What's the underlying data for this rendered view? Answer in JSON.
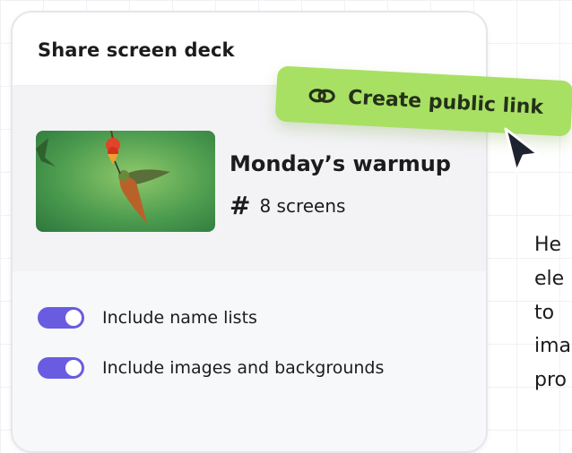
{
  "panel": {
    "title": "Share screen deck"
  },
  "deck": {
    "name": "Monday’s warmup",
    "count_symbol": "#",
    "count_label": "8 screens"
  },
  "options": [
    {
      "label": "Include name lists",
      "enabled": true
    },
    {
      "label": "Include images and backgrounds",
      "enabled": true
    }
  ],
  "cta": {
    "label": "Create public link",
    "icon": "link-icon"
  },
  "side_text": [
    "He",
    "ele",
    "to",
    "ima",
    "pro"
  ],
  "colors": {
    "accent_green": "#a8e063",
    "toggle_on": "#6a5ce0",
    "text_dark": "#1c1c1f"
  }
}
